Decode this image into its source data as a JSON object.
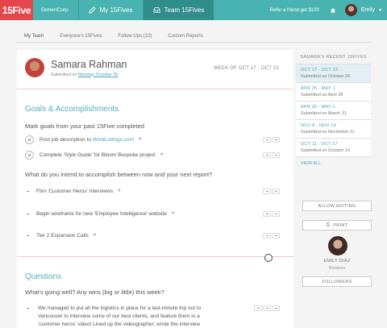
{
  "topbar": {
    "logo": "15Five",
    "org": "GeneriCorp",
    "tabs": [
      {
        "label": "My 15Fives",
        "icon": "pencil-icon",
        "active": false
      },
      {
        "label": "Team 15Fives",
        "icon": "inbox-icon",
        "active": true
      }
    ],
    "refer_label": "Refer a friend get $100",
    "user": "Emily",
    "colors": {
      "bar": "#48b3b0",
      "logo": "#e5464b",
      "active_tab": "#2f8d8a"
    }
  },
  "subnav": {
    "tabs": [
      "My Team",
      "Everyone's 15Fives",
      "Follow Ups (22)",
      "Custom Reports"
    ]
  },
  "report": {
    "person_name": "Samara Rahman",
    "submitted_prefix": "Submitted on",
    "submitted_date": "Monday, October 26",
    "week": "WEEK OF OCT 17 - OCT 23",
    "goals": {
      "title": "Goals & Accomplishments",
      "q1": "Mark goals from your past 15Five completed",
      "completed": [
        {
          "text": "Post job description to",
          "link": "WorkListings.com"
        },
        {
          "text": "Complete 'Style Guide' for Bloom Bespoke project",
          "link": ""
        }
      ],
      "q2": "What do you intend to accomplish between now and your next report?",
      "planned": [
        "Film 'Customer Heros' Interviews",
        "Begin wireframe for new 'Employee Intelligence' website",
        "Tier 2 Expansion Calls"
      ]
    },
    "questions": {
      "title": "Questions",
      "q1": "What's going well? Any wins (big or little) this week?",
      "answer_lines": [
        "We managed to put all the logistics in place for a last-minute trip out to",
        "Vancouver to interview some of our best clients, and feature them in a",
        "'customer heros' video! Lined up the videographer, wrote the interview"
      ]
    },
    "accent": "#4fb0b9"
  },
  "sidebar": {
    "title": "SAMARA'S RECENT 15FIVES",
    "items": [
      {
        "range": "OCT 17 - OCT 23",
        "sub": "Submitted on October 26",
        "active": true
      },
      {
        "range": "APR 25 - MAY 1",
        "sub": "Submitted on April 28",
        "active": false
      },
      {
        "range": "APR 25 - MAY 1",
        "sub": "Submitted on March 31",
        "active": false
      },
      {
        "range": "NOV 8 - NOV 14",
        "sub": "Submitted on November 11",
        "active": false
      },
      {
        "range": "OCT 11 - OCT 17",
        "sub": "Submitted on October 14",
        "active": false
      }
    ],
    "view_all": "VIEW ALL",
    "allow_editing": "ALLOW EDITING",
    "print": "PRINT",
    "reviewer_name": "EMILY DIAZ",
    "reviewer_role": "Reviewer",
    "followers": "FOLLOWERS"
  }
}
